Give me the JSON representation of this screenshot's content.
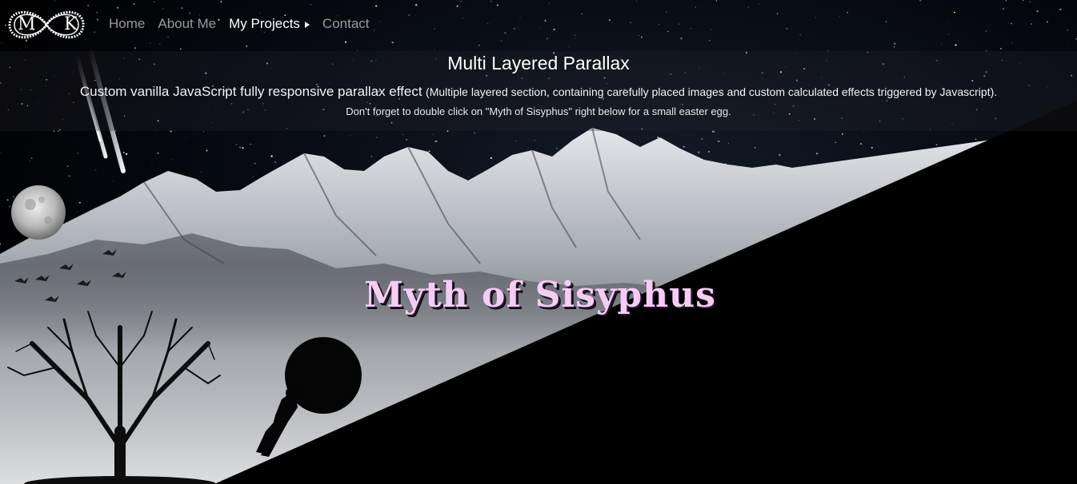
{
  "nav": {
    "logo_left": "M",
    "logo_right": "K",
    "links": [
      {
        "label": "Home",
        "active": false
      },
      {
        "label": "About Me",
        "active": false
      },
      {
        "label": "My Projects",
        "active": true
      },
      {
        "label": "Contact",
        "active": false
      }
    ]
  },
  "header": {
    "title": "Multi Layered Parallax",
    "line1_main": "Custom vanilla JavaScript fully responsive parallax effect",
    "line1_detail": "(Multiple layered section, containing carefully placed images and custom calculated effects triggered by Javascript).",
    "line2": "Don't forget to double click on \"Myth of Sisyphus\" right below for a small easter egg."
  },
  "hero": {
    "title": "Myth of Sisyphus"
  },
  "colors": {
    "background": "#000000",
    "title_pink": "#f4cdf4",
    "nav_inactive": "#9a9a9a",
    "nav_active": "#ffffff"
  }
}
